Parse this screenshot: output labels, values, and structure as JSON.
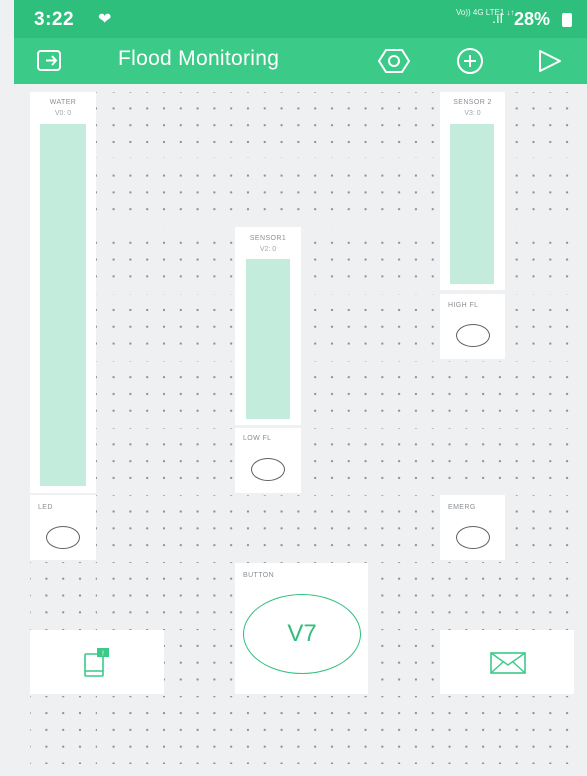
{
  "status_bar": {
    "time": "3:22",
    "network": "Vo)) 4G LTE1 ↓↑",
    "battery": "28%"
  },
  "toolbar": {
    "title": "Flood Monitoring"
  },
  "widgets": {
    "water": {
      "label": "WATER",
      "pin": "V0: 0"
    },
    "sensor1": {
      "label": "SENSOR1",
      "pin": "V2: 0"
    },
    "sensor2": {
      "label": "SENSOR 2",
      "pin": "V3: 0"
    },
    "high": {
      "label": "HIGH FL"
    },
    "low": {
      "label": "LOW FL"
    },
    "led": {
      "label": "LED"
    },
    "emerg": {
      "label": "EMERG"
    },
    "button": {
      "label": "BUTTON",
      "value": "V7"
    }
  },
  "colors": {
    "accent": "#3cca88",
    "statusbar": "#2fbf7c",
    "bar": "#c4ecdd"
  }
}
